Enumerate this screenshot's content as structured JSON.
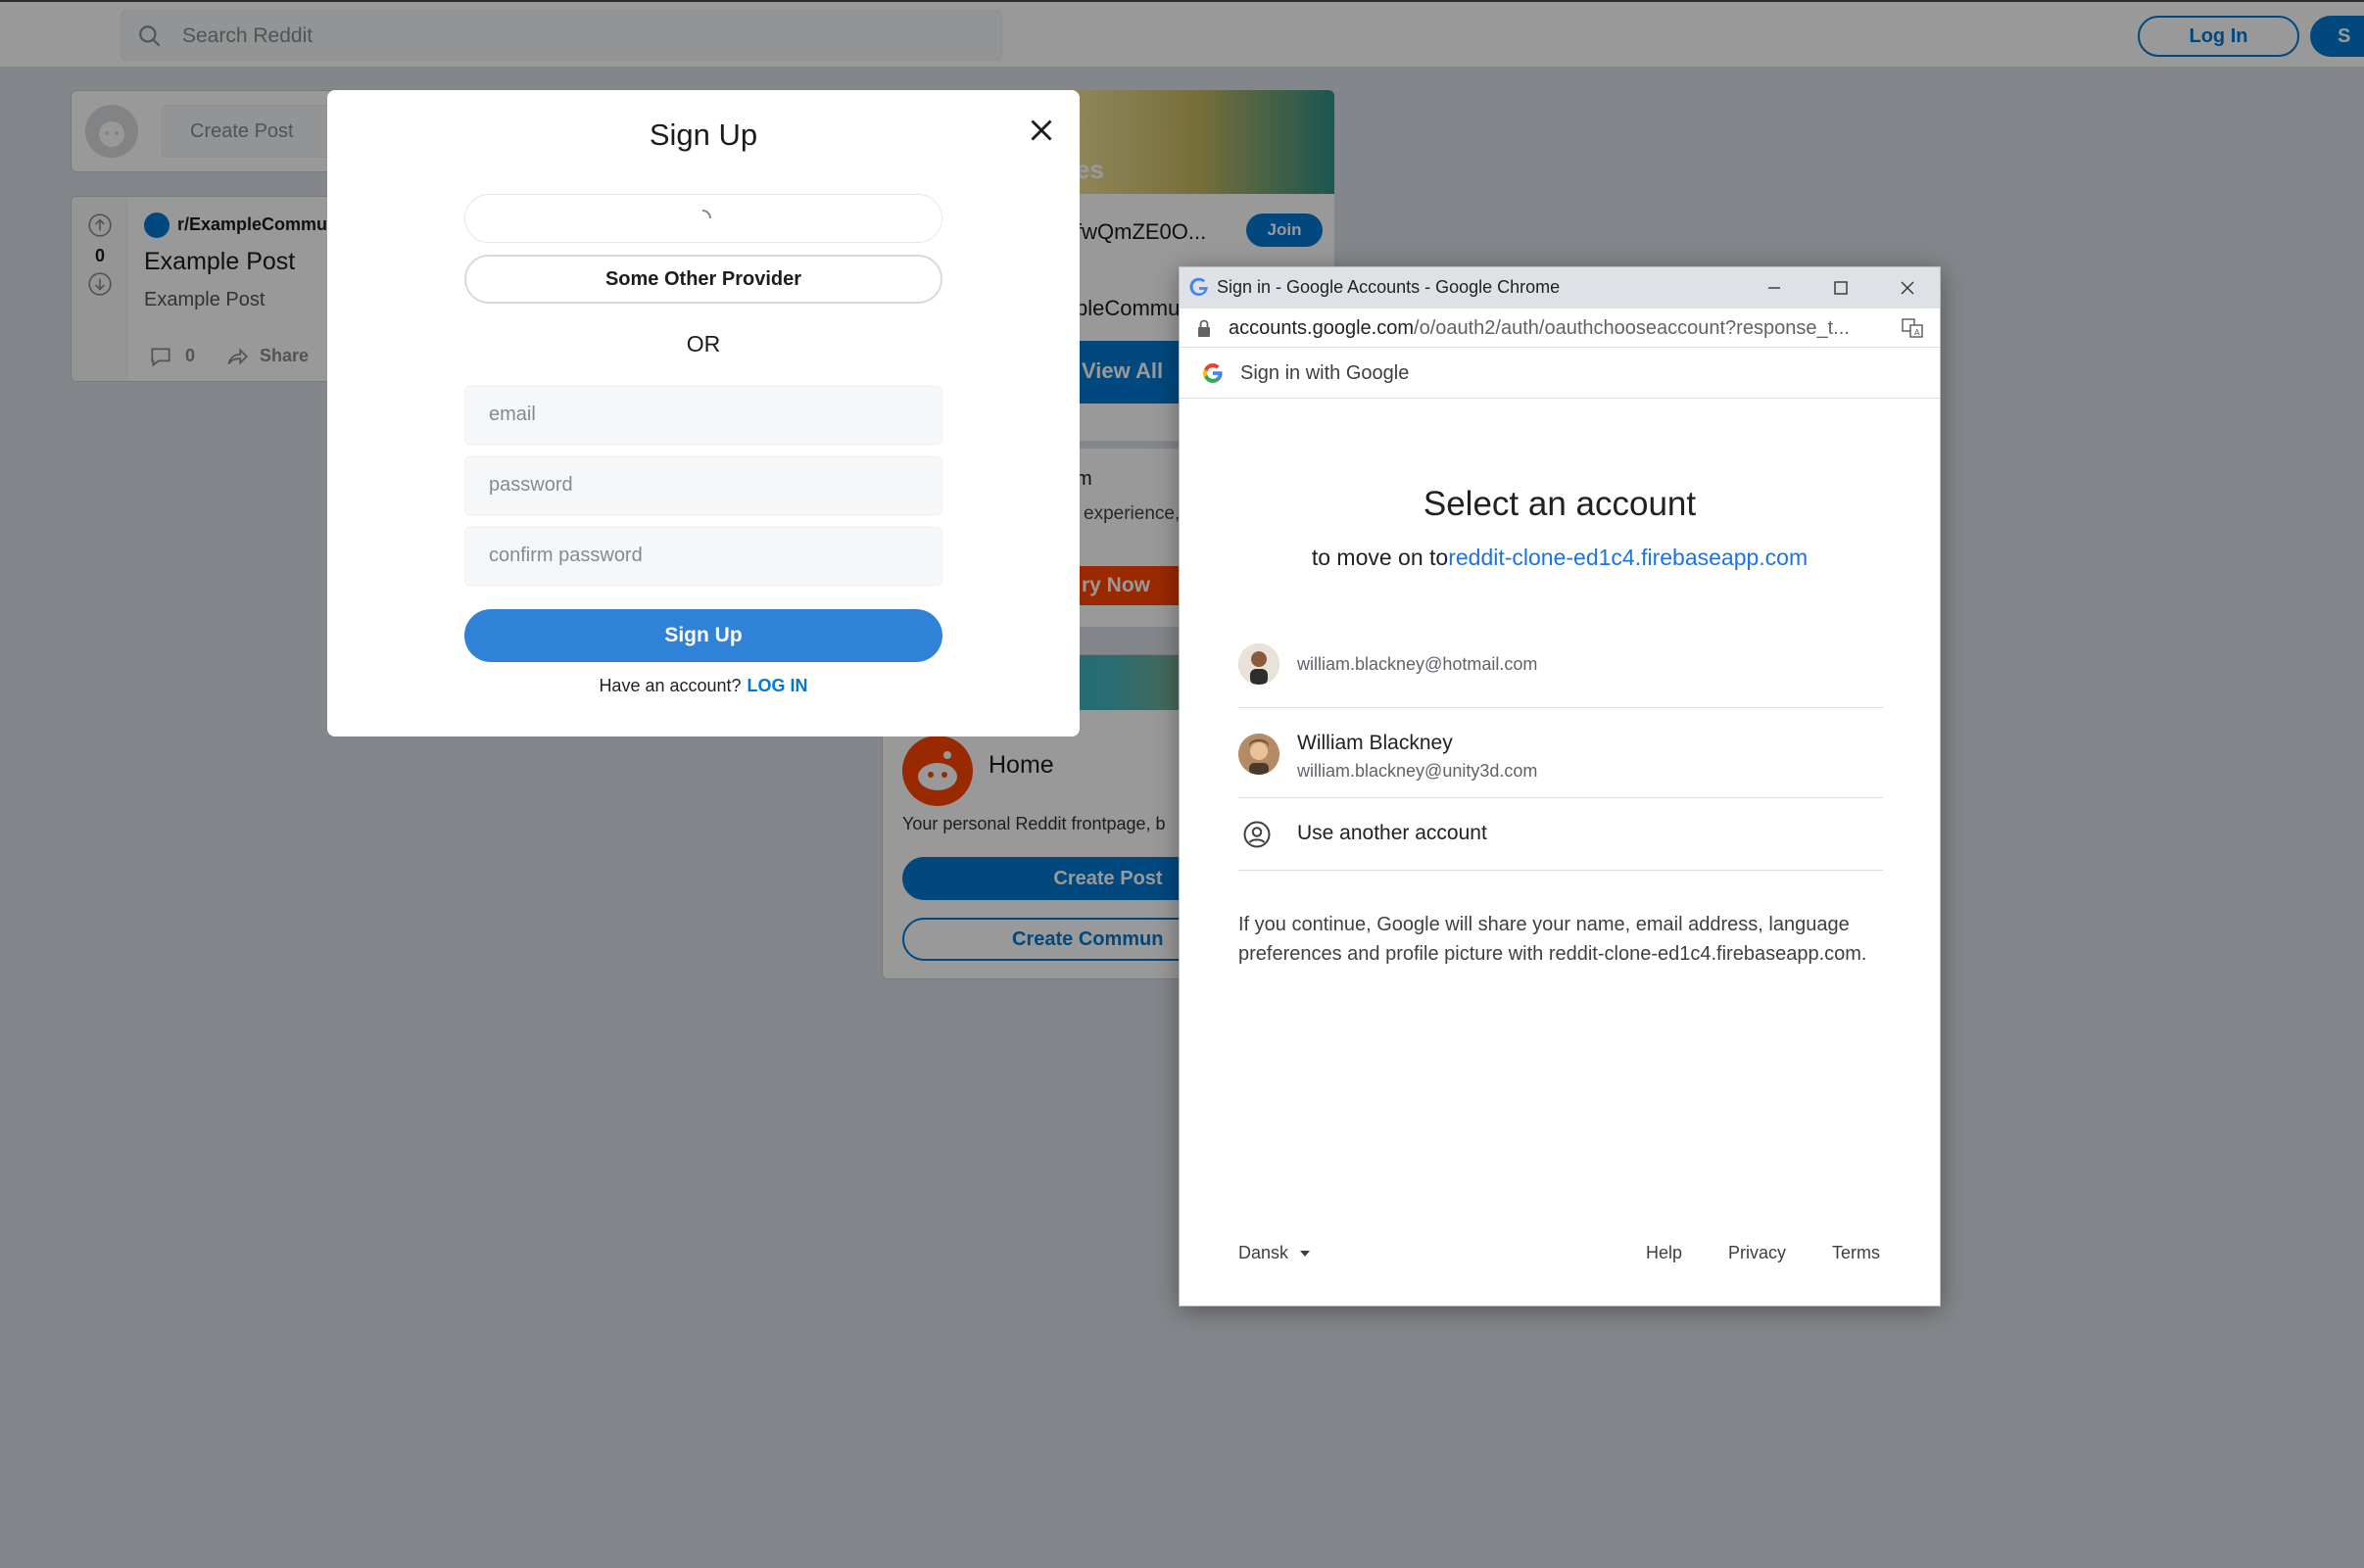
{
  "reddit": {
    "search_placeholder": "Search Reddit",
    "login_label": "Log In",
    "signup_label_partial": "S",
    "create_post_placeholder": "Create Post",
    "post": {
      "vote_count": "0",
      "subreddit": "r/ExampleCommunity",
      "title": "Example Post",
      "body": "Example Post",
      "comment_count": "0",
      "share_label": "Share"
    },
    "communities_card": {
      "banner_text_partial": "es",
      "community_name_partial": "fwQmZE0O...",
      "join_label": "Join",
      "community_2_partial": "pleCommu",
      "view_all_label": "View All"
    },
    "premium_card": {
      "heading_partial": "m",
      "text_partial": "experience,",
      "button_partial": "ry Now"
    },
    "home_card": {
      "title": "Home",
      "description_partial": "Your personal Reddit frontpage, b",
      "create_post_label": "Create Post",
      "create_community_partial": "Create Commun"
    }
  },
  "signup_modal": {
    "title": "Sign Up",
    "other_provider_label": "Some Other Provider",
    "or_label": "OR",
    "email_placeholder": "email",
    "password_placeholder": "password",
    "confirm_placeholder": "confirm password",
    "submit_label": "Sign Up",
    "have_account_text": "Have an account?",
    "login_link": "LOG IN"
  },
  "google_popup": {
    "window_title": "Sign in - Google Accounts - Google Chrome",
    "url_host": "accounts.google.com",
    "url_path": "/o/oauth2/auth/oauthchooseaccount?response_t...",
    "header_text": "Sign in with Google",
    "heading": "Select an account",
    "subheading_prefix": "to move on to",
    "subheading_link": "reddit-clone-ed1c4.firebaseapp.com",
    "accounts": [
      {
        "email": "william.blackney@hotmail.com"
      },
      {
        "name": "William Blackney",
        "email": "william.blackney@unity3d.com"
      }
    ],
    "use_another": "Use another account",
    "consent": "If you continue, Google will share your name, email address, language preferences and profile picture with reddit-clone-ed1c4.firebaseapp.com.",
    "footer": {
      "language": "Dansk",
      "help": "Help",
      "privacy": "Privacy",
      "terms": "Terms"
    }
  },
  "colors": {
    "reddit_blue": "#0079d3",
    "reddit_orange": "#ff4500",
    "google_blue": "#1a73e8"
  }
}
